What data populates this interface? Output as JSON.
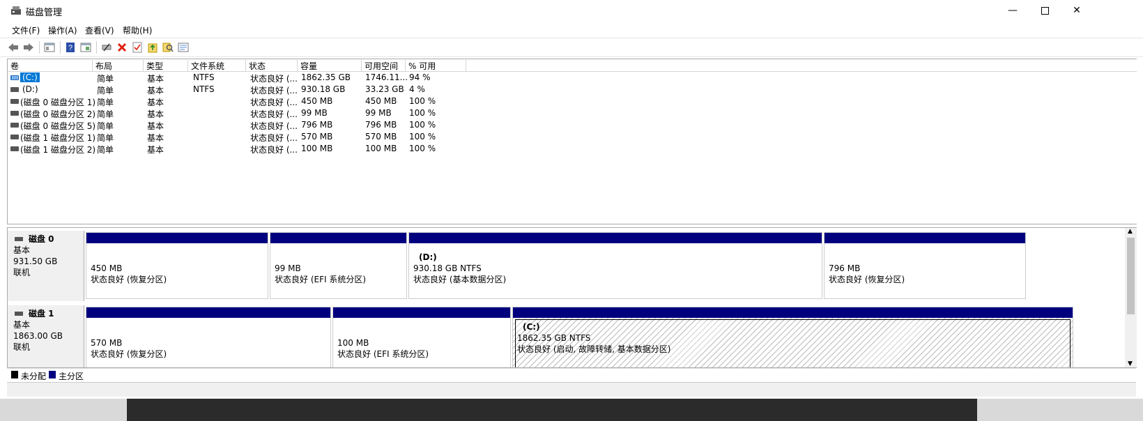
{
  "window": {
    "title": "磁盘管理"
  },
  "menu": [
    "文件(F)",
    "操作(A)",
    "查看(V)",
    "帮助(H)"
  ],
  "toolbar": [
    "back-icon",
    "forward-icon",
    "console-tree-icon",
    "help-icon",
    "properties-view-icon",
    "connect-icon",
    "delete-icon",
    "check-icon",
    "export-icon",
    "search-icon",
    "properties-icon"
  ],
  "list": {
    "columns": [
      "卷",
      "布局",
      "类型",
      "文件系统",
      "状态",
      "容量",
      "可用空间",
      "% 可用"
    ],
    "rows": [
      {
        "vol": "(C:)",
        "layout": "简单",
        "type": "基本",
        "fs": "NTFS",
        "status": "状态良好 (...",
        "cap": "1862.35 GB",
        "free": "1746.11...",
        "pct": "94 %"
      },
      {
        "vol": "(D:)",
        "layout": "简单",
        "type": "基本",
        "fs": "NTFS",
        "status": "状态良好 (...",
        "cap": "930.18 GB",
        "free": "33.23 GB",
        "pct": "4 %"
      },
      {
        "vol": "(磁盘 0 磁盘分区 1)",
        "layout": "简单",
        "type": "基本",
        "fs": "",
        "status": "状态良好 (...",
        "cap": "450 MB",
        "free": "450 MB",
        "pct": "100 %"
      },
      {
        "vol": "(磁盘 0 磁盘分区 2)",
        "layout": "简单",
        "type": "基本",
        "fs": "",
        "status": "状态良好 (...",
        "cap": "99 MB",
        "free": "99 MB",
        "pct": "100 %"
      },
      {
        "vol": "(磁盘 0 磁盘分区 5)",
        "layout": "简单",
        "type": "基本",
        "fs": "",
        "status": "状态良好 (...",
        "cap": "796 MB",
        "free": "796 MB",
        "pct": "100 %"
      },
      {
        "vol": "(磁盘 1 磁盘分区 1)",
        "layout": "简单",
        "type": "基本",
        "fs": "",
        "status": "状态良好 (...",
        "cap": "570 MB",
        "free": "570 MB",
        "pct": "100 %"
      },
      {
        "vol": "(磁盘 1 磁盘分区 2)",
        "layout": "简单",
        "type": "基本",
        "fs": "",
        "status": "状态良好 (...",
        "cap": "100 MB",
        "free": "100 MB",
        "pct": "100 %"
      }
    ]
  },
  "disks": [
    {
      "name": "磁盘 0",
      "kind": "基本",
      "size": "931.50 GB",
      "state": "联机",
      "parts": [
        {
          "label": "",
          "size": "450 MB",
          "status": "状态良好 (恢复分区)"
        },
        {
          "label": "",
          "size": "99 MB",
          "status": "状态良好 (EFI 系统分区)"
        },
        {
          "label": "(D:)",
          "size": "930.18 GB NTFS",
          "status": "状态良好 (基本数据分区)"
        },
        {
          "label": "",
          "size": "796 MB",
          "status": "状态良好 (恢复分区)"
        }
      ]
    },
    {
      "name": "磁盘 1",
      "kind": "基本",
      "size": "1863.00 GB",
      "state": "联机",
      "parts": [
        {
          "label": "",
          "size": "570 MB",
          "status": "状态良好 (恢复分区)"
        },
        {
          "label": "",
          "size": "100 MB",
          "status": "状态良好 (EFI 系统分区)"
        },
        {
          "label": "(C:)",
          "size": "1862.35 GB NTFS",
          "status": "状态良好 (启动, 故障转储, 基本数据分区)"
        }
      ]
    }
  ],
  "legend": {
    "unallocated": "未分配",
    "primary": "主分区",
    "unallocated_color": "#000000",
    "primary_color": "#00007f"
  }
}
